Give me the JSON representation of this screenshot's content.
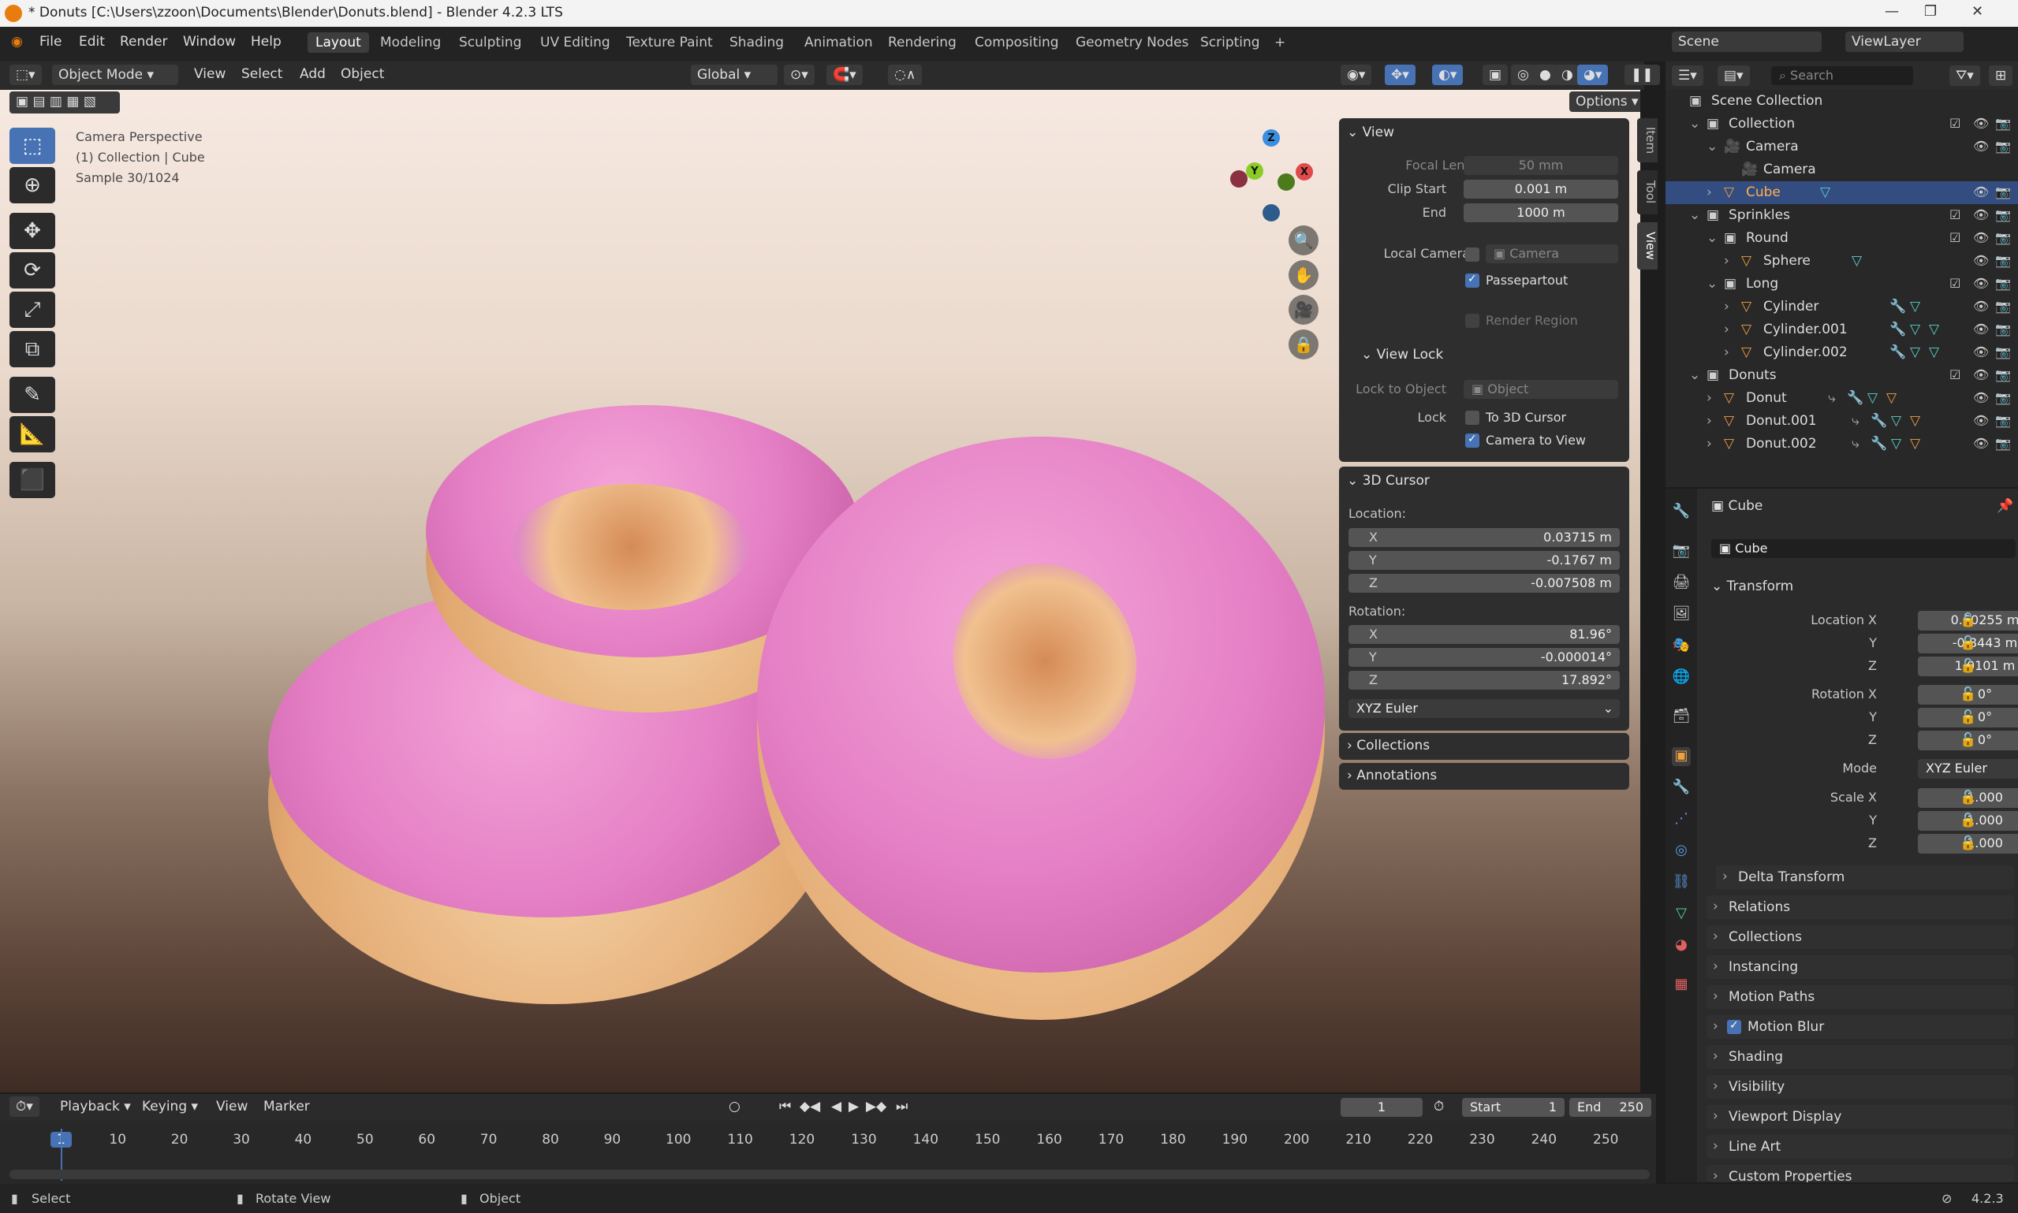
{
  "window": {
    "title": "* Donuts [C:\\Users\\zzoon\\Documents\\Blender\\Donuts.blend] - Blender 4.2.3 LTS"
  },
  "menu": [
    "File",
    "Edit",
    "Render",
    "Window",
    "Help"
  ],
  "workspaces": [
    "Layout",
    "Modeling",
    "Sculpting",
    "UV Editing",
    "Texture Paint",
    "Shading",
    "Animation",
    "Rendering",
    "Compositing",
    "Geometry Nodes",
    "Scripting",
    "+"
  ],
  "scene_field": "Scene",
  "viewlayer_field": "ViewLayer",
  "header3d": {
    "mode": "Object Mode",
    "view": "View",
    "select": "Select",
    "add": "Add",
    "object": "Object",
    "orientation": "Global",
    "options": "Options"
  },
  "viewport_overlay": {
    "line1": "Camera Perspective",
    "line2": "(1) Collection | Cube",
    "line3": "Sample 30/1024"
  },
  "gizmo": {
    "x": "X",
    "y": "Y",
    "z": "Z"
  },
  "npanel": {
    "tabs": [
      "Item",
      "Tool",
      "View"
    ],
    "view": {
      "title": "View",
      "focal_label": "Focal Length",
      "focal": "50 mm",
      "clip_start_label": "Clip Start",
      "clip_start": "0.001 m",
      "end_label": "End",
      "end": "1000 m",
      "local_camera_label": "Local Camera",
      "camera_placeholder": "Camera",
      "passepartout": "Passepartout",
      "render_region": "Render Region"
    },
    "view_lock": {
      "title": "View Lock",
      "lock_to_object_label": "Lock to Object",
      "object_placeholder": "Object",
      "lock_label": "Lock",
      "to_cursor": "To 3D Cursor",
      "camera_to_view": "Camera to View"
    },
    "cursor": {
      "title": "3D Cursor",
      "location_label": "Location:",
      "loc_x": "0.03715 m",
      "loc_y": "-0.1767 m",
      "loc_z": "-0.007508 m",
      "rotation_label": "Rotation:",
      "rot_x": "81.96°",
      "rot_y": "-0.000014°",
      "rot_z": "17.892°",
      "mode": "XYZ Euler"
    },
    "collections": "Collections",
    "annotations": "Annotations"
  },
  "outliner": {
    "search_placeholder": "Search",
    "rows": [
      {
        "name": "Scene Collection",
        "indent": 0
      },
      {
        "name": "Collection",
        "indent": 1
      },
      {
        "name": "Camera",
        "indent": 2
      },
      {
        "name": "Camera",
        "indent": 3
      },
      {
        "name": "Cube",
        "indent": 2
      },
      {
        "name": "Sprinkles",
        "indent": 1
      },
      {
        "name": "Round",
        "indent": 2
      },
      {
        "name": "Sphere",
        "indent": 3
      },
      {
        "name": "Long",
        "indent": 2
      },
      {
        "name": "Cylinder",
        "indent": 3
      },
      {
        "name": "Cylinder.001",
        "indent": 3
      },
      {
        "name": "Cylinder.002",
        "indent": 3
      },
      {
        "name": "Donuts",
        "indent": 1
      },
      {
        "name": "Donut",
        "indent": 2
      },
      {
        "name": "Donut.001",
        "indent": 2
      },
      {
        "name": "Donut.002",
        "indent": 2
      }
    ]
  },
  "properties": {
    "object_name": "Cube",
    "data_name": "Cube",
    "transform": "Transform",
    "location_x_label": "Location X",
    "loc_x": "0.60255 m",
    "y_label": "Y",
    "loc_y": "-0.8443 m",
    "z_label": "Z",
    "loc_z": "1.0101 m",
    "rotation_x_label": "Rotation X",
    "rot_x": "0°",
    "rot_y": "0°",
    "rot_z": "0°",
    "mode_label": "Mode",
    "mode": "XYZ Euler",
    "scale_x_label": "Scale X",
    "scale_x": "1.000",
    "scale_y": "1.000",
    "scale_z": "1.000",
    "sections": [
      "Delta Transform",
      "Relations",
      "Collections",
      "Instancing",
      "Motion Paths",
      "Motion Blur",
      "Shading",
      "Visibility",
      "Viewport Display",
      "Line Art",
      "Custom Properties"
    ]
  },
  "timeline": {
    "playback": "Playback",
    "keying": "Keying",
    "view": "View",
    "marker": "Marker",
    "current_frame": "1",
    "start_label": "Start",
    "start": "1",
    "end_label": "End",
    "end": "250",
    "ticks": [
      "1",
      "10",
      "20",
      "30",
      "40",
      "50",
      "60",
      "70",
      "80",
      "90",
      "100",
      "110",
      "120",
      "130",
      "140",
      "150",
      "160",
      "170",
      "180",
      "190",
      "200",
      "210",
      "220",
      "230",
      "240",
      "250"
    ]
  },
  "status": {
    "select": "Select",
    "rotate": "Rotate View",
    "object": "Object",
    "version": "4.2.3"
  }
}
